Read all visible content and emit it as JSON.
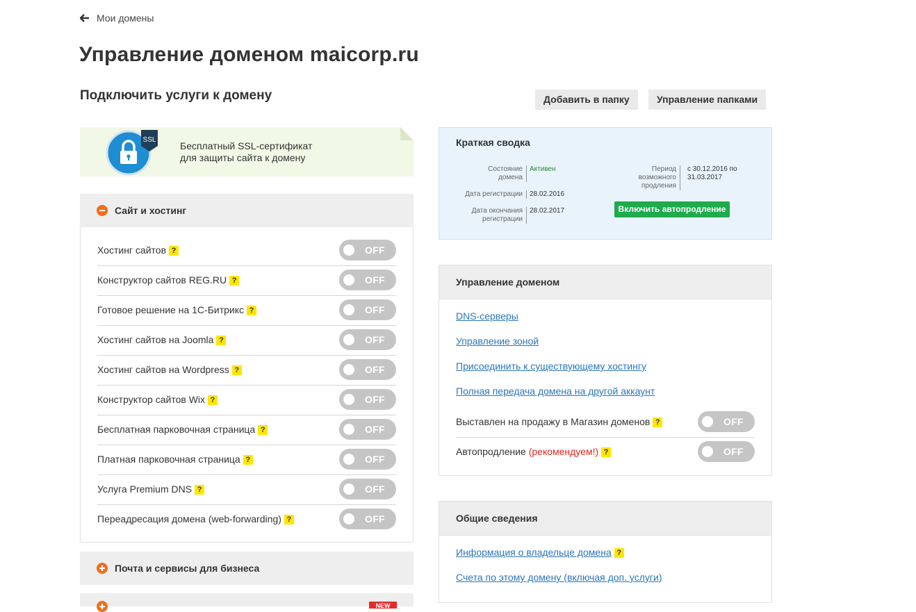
{
  "back": {
    "label": "Мои домены"
  },
  "page_title": "Управление доменом maicorp.ru",
  "subtitle": "Подключить услуги к домену",
  "toolbar": {
    "add_to_folder": "Добавить в папку",
    "manage_folders": "Управление папками"
  },
  "ssl_banner": {
    "badge": "SSL",
    "line1": "Бесплатный SSL-сертификат",
    "line2": "для защиты сайта к домену"
  },
  "hosting_section": {
    "title": "Сайт и хостинг",
    "items": [
      {
        "label": "Хостинг сайтов",
        "help": "?",
        "state": "OFF"
      },
      {
        "label": "Конструктор сайтов REG.RU",
        "help": "?",
        "state": "OFF"
      },
      {
        "label": "Готовое решение на 1С-Битрикс",
        "help": "?",
        "state": "OFF"
      },
      {
        "label": "Хостинг сайтов на Joomla",
        "help": "?",
        "state": "OFF"
      },
      {
        "label": "Хостинг сайтов на Wordpress",
        "help": "?",
        "state": "OFF"
      },
      {
        "label": "Конструктор сайтов Wix",
        "help": "?",
        "state": "OFF"
      },
      {
        "label": "Бесплатная парковочная страница",
        "help": "?",
        "state": "OFF"
      },
      {
        "label": "Платная парковочная страница",
        "help": "?",
        "state": "OFF"
      },
      {
        "label": "Услуга Premium DNS",
        "help": "?",
        "state": "OFF"
      },
      {
        "label": "Переадресация домена (web-forwarding)",
        "help": "?",
        "state": "OFF"
      }
    ]
  },
  "mail_section": {
    "title": "Почта и сервисы для бизнеса"
  },
  "new_badge": "NEW",
  "summary": {
    "title": "Краткая сводка",
    "status_label": "Состояние домена",
    "status_value": "Активен",
    "reg_date_label": "Дата регистрации",
    "reg_date_value": "28.02.2016",
    "expire_label": "Дата окончания регистрации",
    "expire_value": "28.02.2017",
    "renew_period_label": "Период возможного продления",
    "renew_period_value": "с 30.12.2016 по 31.03.2017",
    "autorenew_button": "Включить автопродление"
  },
  "domain_mgmt": {
    "title": "Управление доменом",
    "links": [
      "DNS-серверы",
      "Управление зоной",
      "Присоединить к существующему хостингу",
      "Полная передача домена на другой аккаунт"
    ],
    "for_sale": {
      "label": "Выставлен на продажу в Магазин доменов",
      "help": "?",
      "state": "OFF"
    },
    "autorenew": {
      "label": "Автопродление",
      "recommend": "(рекомендуем!)",
      "help": "?",
      "state": "OFF"
    }
  },
  "general_info": {
    "title": "Общие сведения",
    "owner_link": "Информация о владельце домена",
    "owner_help": "?",
    "invoices_link": "Счета по этому домену (включая доп. услуги)"
  },
  "colors": {
    "link": "#2a76b9",
    "toggle_off": "#c5c5c5",
    "help_badge": "#ffe600",
    "accent_orange": "#f26d1c",
    "green_button": "#1faa4d",
    "recommend_red": "#e0261e"
  }
}
